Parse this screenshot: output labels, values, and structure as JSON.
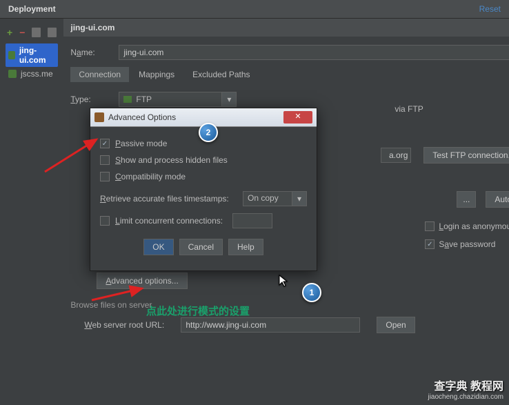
{
  "header": {
    "title": "Deployment",
    "reset": "Reset"
  },
  "sidebar": {
    "items": [
      {
        "label": "jing-ui.com",
        "selected": true,
        "bold": true
      },
      {
        "label": "jscss.me",
        "selected": false,
        "bold": false
      }
    ]
  },
  "panel": {
    "title": "jing-ui.com",
    "name_label": "Name:",
    "name_value": "jing-ui.com",
    "tabs": [
      "Connection",
      "Mappings",
      "Excluded Paths"
    ],
    "type_label": "Type:",
    "type_value": "FTP",
    "via_text": "via FTP",
    "host_suffix": "a.org",
    "test_btn": "Test FTP connection...",
    "dots_btn": "...",
    "autodetect_btn": "Autodetect",
    "anon_label": "Login as anonymous",
    "savepw_label": "Save password",
    "adv_btn": "Advanced options...",
    "browse_label": "Browse files on server",
    "webroot_label": "Web server root URL:",
    "webroot_value": "http://www.jing-ui.com",
    "open_btn": "Open"
  },
  "dialog": {
    "title": "Advanced Options",
    "passive": "Passive mode",
    "hidden": "Show and process hidden files",
    "compat": "Compatibility mode",
    "retrieve": "Retrieve accurate files timestamps:",
    "retrieve_value": "On copy",
    "limit": "Limit concurrent connections:",
    "ok": "OK",
    "cancel": "Cancel",
    "help": "Help"
  },
  "annotation": {
    "text": "点此处进行模式的设置"
  },
  "badges": {
    "b1": "1",
    "b2": "2"
  },
  "watermark": {
    "main": "查字典 教程网",
    "sub": "jiaocheng.chazidian.com"
  }
}
